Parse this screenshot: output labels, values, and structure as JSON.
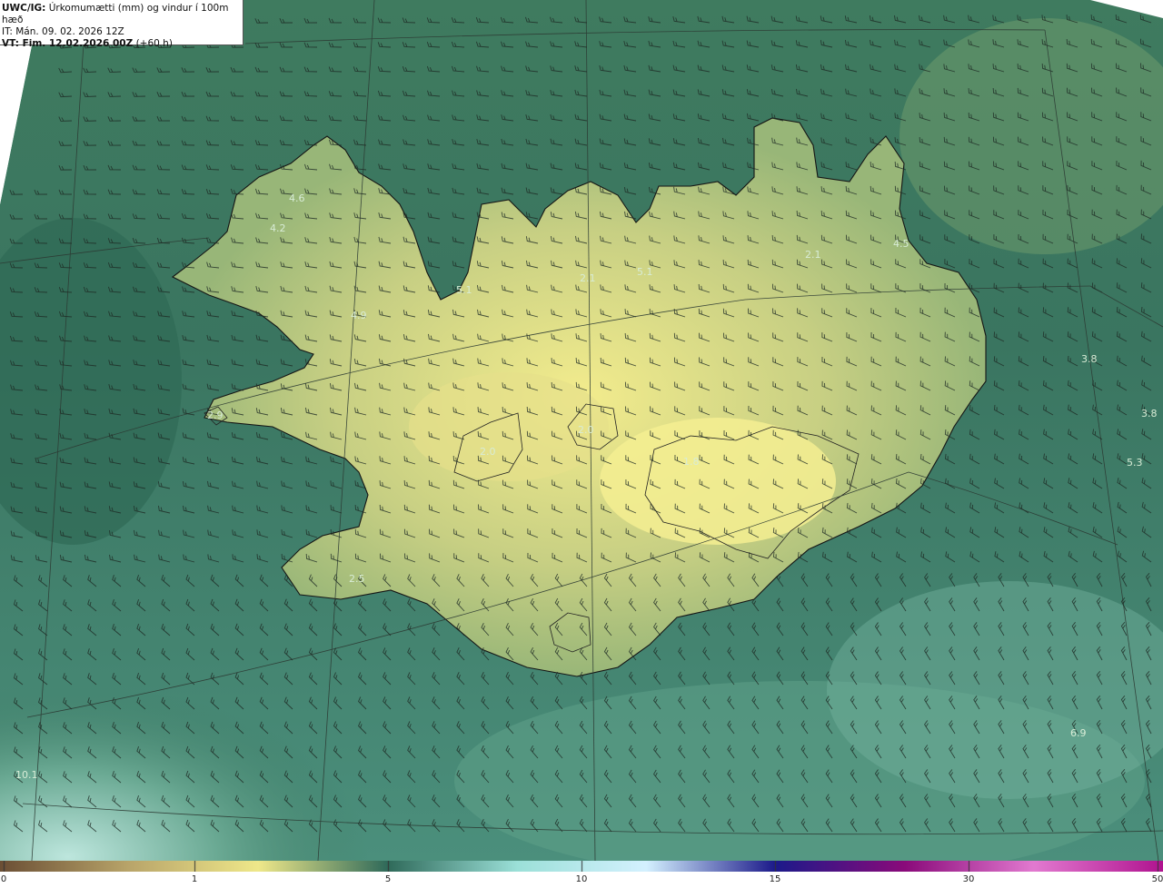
{
  "header": {
    "title_bold": "UWC/IG:",
    "title_rest": " Úrkomumætti (mm) og vindur í 100m hæð",
    "initial_time": "IT: Mán. 09. 02. 2026 12Z",
    "valid_time_bold": "VT: Fim. 12.02.2026 00Z",
    "valid_time_rest": " (+60 h)"
  },
  "map_labels": [
    {
      "text": "4.6"
    },
    {
      "text": "4.2"
    },
    {
      "text": "5.1"
    },
    {
      "text": "4.9"
    },
    {
      "text": "2.1"
    },
    {
      "text": "5.1"
    },
    {
      "text": "2.1"
    },
    {
      "text": "4.5"
    },
    {
      "text": "3.8"
    },
    {
      "text": "3.8"
    },
    {
      "text": "5.3"
    },
    {
      "text": "2.9"
    },
    {
      "text": "2.0"
    },
    {
      "text": "2.0"
    },
    {
      "text": "1.8"
    },
    {
      "text": "2.5"
    },
    {
      "text": "6.9"
    },
    {
      "text": "10.1"
    }
  ],
  "legend": {
    "ticks": [
      {
        "label": "0",
        "value": 0
      },
      {
        "label": "1",
        "value": 1
      },
      {
        "label": "5",
        "value": 5
      },
      {
        "label": "10",
        "value": 10
      },
      {
        "label": "15",
        "value": 15
      },
      {
        "label": "30",
        "value": 30
      },
      {
        "label": "50",
        "value": 50
      }
    ],
    "colors": [
      "#6b4f35",
      "#b9a56a",
      "#efe88a",
      "#2f6a5a",
      "#9be0d8",
      "#d4f1ff",
      "#1c1a8a",
      "#8a0a7a",
      "#e27ad0",
      "#b0138f"
    ]
  },
  "colors": {
    "land_bright": "#e9e38a",
    "land_mid": "#a9bf7b",
    "sea": "#3f7f66",
    "sea_light": "#8fc9b8",
    "coastline": "#151515",
    "grid": "#2c3a33"
  }
}
